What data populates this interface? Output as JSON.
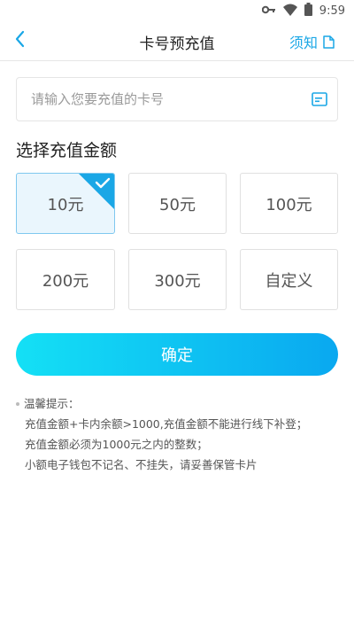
{
  "status_bar": {
    "time": "9:59",
    "icons": [
      "key-icon",
      "wifi-icon",
      "battery-icon"
    ]
  },
  "header": {
    "title": "卡号预充值",
    "notice_label": "须知",
    "accent_color": "#1aa7e6"
  },
  "card_input": {
    "placeholder": "请输入您要充值的卡号",
    "value": ""
  },
  "amount_section": {
    "title": "选择充值金额",
    "options": [
      {
        "label": "10元",
        "selected": true
      },
      {
        "label": "50元",
        "selected": false
      },
      {
        "label": "100元",
        "selected": false
      },
      {
        "label": "200元",
        "selected": false
      },
      {
        "label": "300元",
        "selected": false
      },
      {
        "label": "自定义",
        "selected": false
      }
    ]
  },
  "confirm_button": {
    "label": "确定"
  },
  "tips": {
    "title": "温馨提示：",
    "lines": [
      "充值金额+卡内余额>1000,充值金额不能进行线下补登；",
      "充值金额必须为1000元之内的整数；",
      "小额电子钱包不记名、不挂失，请妥善保管卡片"
    ]
  }
}
